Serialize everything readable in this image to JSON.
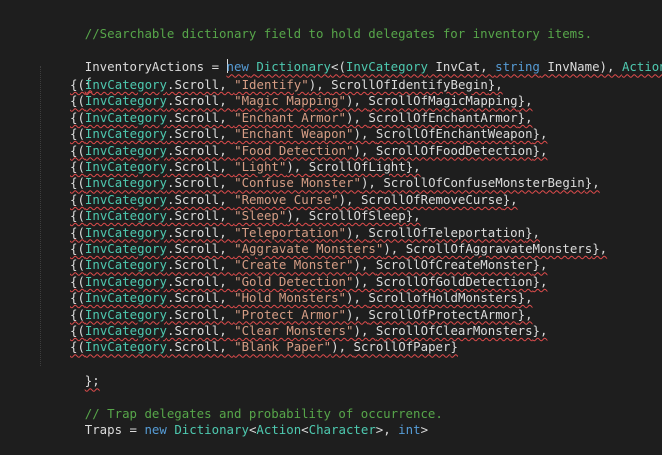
{
  "editor": {
    "comment1": "//Searchable dictionary field to hold delegates for inventory items.",
    "decl": {
      "var": "InventoryActions",
      "eq": " = ",
      "kw_new": "new",
      "dictionary": "Dictionary",
      "open_generic": "<(",
      "invcat_type": "InvCategory",
      "invcat_name": " InvCat, ",
      "kw_string": "string",
      "invname": " InvName), ",
      "action": "Action",
      "close_generic": ">"
    },
    "open_brace": "{",
    "close_brace": "};",
    "entries": [
      {
        "prefix": "{(",
        "cat": "InvCategory",
        "member": ".Scroll, ",
        "str": "\"Identify\"",
        "sep": "), ",
        "handler": "ScrollOfIdentifyBegin",
        "suffix": "},"
      },
      {
        "prefix": "{(",
        "cat": "InvCategory",
        "member": ".Scroll, ",
        "str": "\"Magic Mapping\"",
        "sep": "), ",
        "handler": "ScrollOfMagicMapping",
        "suffix": "},"
      },
      {
        "prefix": "{(",
        "cat": "InvCategory",
        "member": ".Scroll, ",
        "str": "\"Enchant Armor\"",
        "sep": "), ",
        "handler": "ScrollOfEnchantArmor",
        "suffix": "},"
      },
      {
        "prefix": "{(",
        "cat": "InvCategory",
        "member": ".Scroll, ",
        "str": "\"Enchant Weapon\"",
        "sep": "), ",
        "handler": "ScrollOfEnchantWeapon",
        "suffix": "},"
      },
      {
        "prefix": "{(",
        "cat": "InvCategory",
        "member": ".Scroll, ",
        "str": "\"Food Detection\"",
        "sep": "), ",
        "handler": "ScrollOfFoodDetection",
        "suffix": "},"
      },
      {
        "prefix": "{(",
        "cat": "InvCategory",
        "member": ".Scroll, ",
        "str": "\"Light\"",
        "sep": "), ",
        "handler": "ScrollOfLight",
        "suffix": "},"
      },
      {
        "prefix": "{(",
        "cat": "InvCategory",
        "member": ".Scroll, ",
        "str": "\"Confuse Monster\"",
        "sep": "), ",
        "handler": "ScrollOfConfuseMonsterBegin",
        "suffix": "},"
      },
      {
        "prefix": "{(",
        "cat": "InvCategory",
        "member": ".Scroll, ",
        "str": "\"Remove Curse\"",
        "sep": "), ",
        "handler": "ScrollOfRemoveCurse",
        "suffix": "},"
      },
      {
        "prefix": "{(",
        "cat": "InvCategory",
        "member": ".Scroll, ",
        "str": "\"Sleep\"",
        "sep": "), ",
        "handler": "ScrollOfSleep",
        "suffix": "},"
      },
      {
        "prefix": "{(",
        "cat": "InvCategory",
        "member": ".Scroll, ",
        "str": "\"Teleportation\"",
        "sep": "), ",
        "handler": "ScrollOfTeleportation",
        "suffix": "},"
      },
      {
        "prefix": "{(",
        "cat": "InvCategory",
        "member": ".Scroll, ",
        "str": "\"Aggravate Monsters\"",
        "sep": "), ",
        "handler": "ScrollOfAggravateMonsters",
        "suffix": "},"
      },
      {
        "prefix": "{(",
        "cat": "InvCategory",
        "member": ".Scroll, ",
        "str": "\"Create Monster\"",
        "sep": "), ",
        "handler": "ScrollOfCreateMonster",
        "suffix": "},"
      },
      {
        "prefix": "{(",
        "cat": "InvCategory",
        "member": ".Scroll, ",
        "str": "\"Gold Detection\"",
        "sep": "), ",
        "handler": "ScrollOfGoldDetection",
        "suffix": "},"
      },
      {
        "prefix": "{(",
        "cat": "InvCategory",
        "member": ".Scroll, ",
        "str": "\"Hold Monsters\"",
        "sep": "), ",
        "handler": "ScrollofHoldMonsters",
        "suffix": "},"
      },
      {
        "prefix": "{(",
        "cat": "InvCategory",
        "member": ".Scroll, ",
        "str": "\"Protect Armor\"",
        "sep": "), ",
        "handler": "ScrollOfProtectArmor",
        "suffix": "},"
      },
      {
        "prefix": "{(",
        "cat": "InvCategory",
        "member": ".Scroll, ",
        "str": "\"Clear Monsters\"",
        "sep": "), ",
        "handler": "ScrollOfClearMonsters",
        "suffix": "},"
      },
      {
        "prefix": "{(",
        "cat": "InvCategory",
        "member": ".Scroll, ",
        "str": "\"Blank Paper\"",
        "sep": "), ",
        "handler": "ScrollOfPaper",
        "suffix": "}"
      }
    ],
    "comment2": "// Trap delegates and probability of occurrence.",
    "traps": {
      "var": "Traps",
      "eq": " = ",
      "kw_new": "new",
      "dictionary": "Dictionary",
      "lt": "<",
      "action": "Action",
      "lt2": "<",
      "character": "Character",
      "gt": ">, ",
      "kw_int": "int",
      "gt2": ">"
    }
  },
  "colors": {
    "background": "#1e1e1e",
    "keyword": "#569cd6",
    "type": "#4ec9b0",
    "string": "#d69d85",
    "comment": "#57a64a",
    "text": "#dcdcdc",
    "error_squiggle": "#e04c4c"
  }
}
